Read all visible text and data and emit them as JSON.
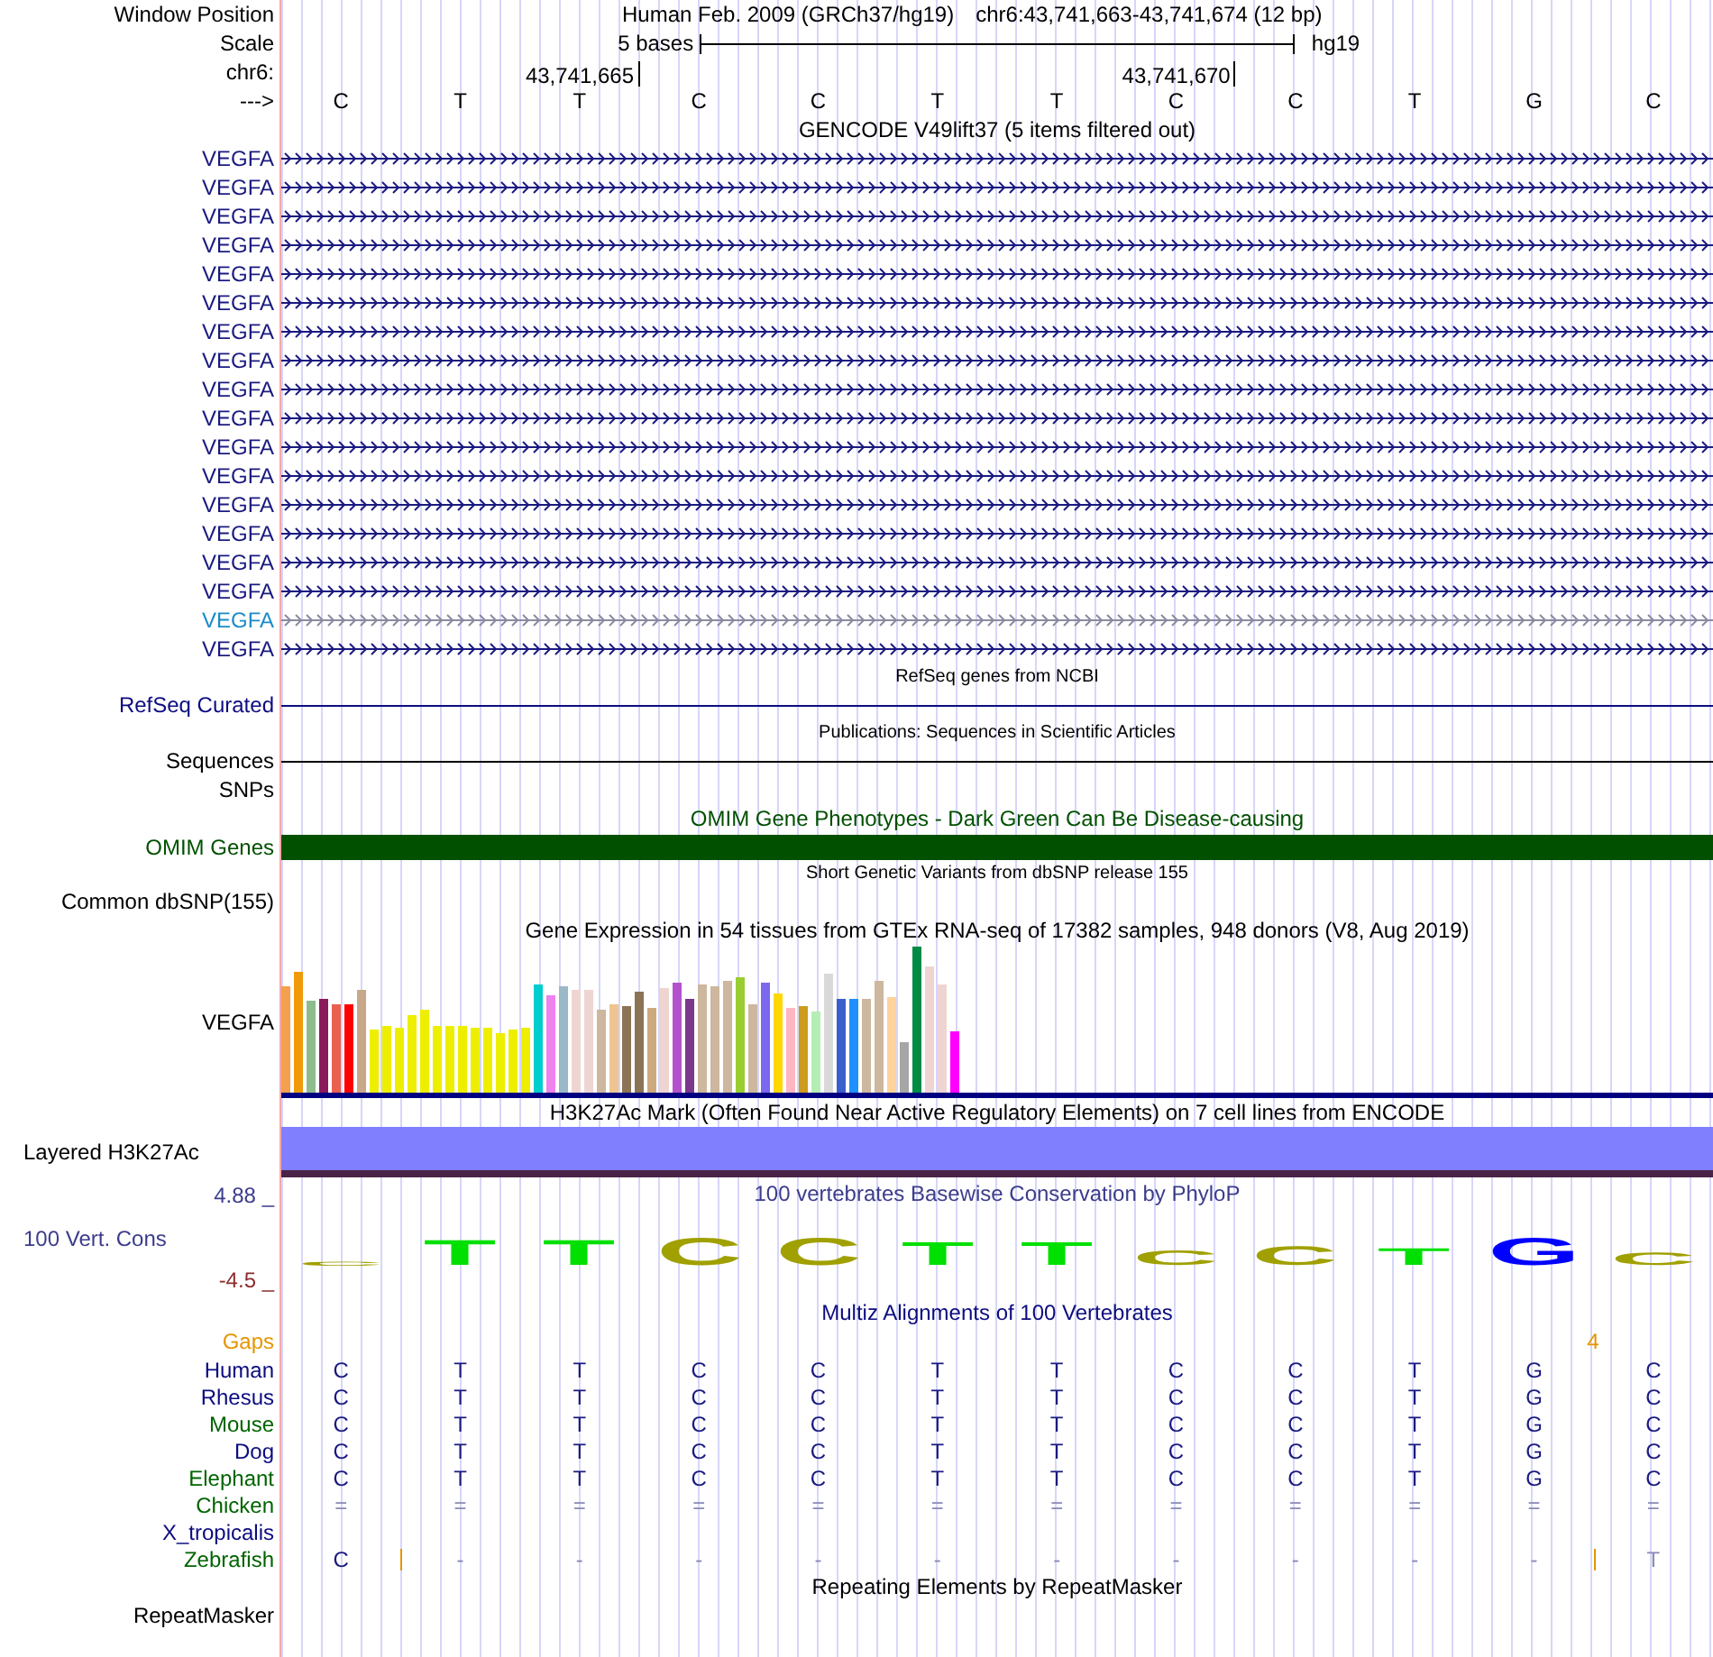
{
  "header": {
    "window_position_label": "Window Position",
    "assembly": "Human Feb. 2009 (GRCh37/hg19)",
    "position": "chr6:43,741,663-43,741,674 (12 bp)",
    "scale_label": "Scale",
    "scale_text": "5 bases",
    "scale_db": "hg19",
    "chrom_label": "chr6:",
    "ticks": [
      "43,741,665",
      "43,741,670"
    ],
    "strand_label": "--->",
    "bases": [
      "C",
      "T",
      "T",
      "C",
      "C",
      "T",
      "T",
      "C",
      "C",
      "T",
      "G",
      "C"
    ]
  },
  "tracks": [
    {
      "kind": "genes",
      "title": "GENCODE V49lift37 (5 items filtered out)",
      "small_title": false,
      "items": [
        {
          "name": "VEGFA",
          "highlighted": false
        },
        {
          "name": "VEGFA",
          "highlighted": false
        },
        {
          "name": "VEGFA",
          "highlighted": false
        },
        {
          "name": "VEGFA",
          "highlighted": false
        },
        {
          "name": "VEGFA",
          "highlighted": false
        },
        {
          "name": "VEGFA",
          "highlighted": false
        },
        {
          "name": "VEGFA",
          "highlighted": false
        },
        {
          "name": "VEGFA",
          "highlighted": false
        },
        {
          "name": "VEGFA",
          "highlighted": false
        },
        {
          "name": "VEGFA",
          "highlighted": false
        },
        {
          "name": "VEGFA",
          "highlighted": false
        },
        {
          "name": "VEGFA",
          "highlighted": false
        },
        {
          "name": "VEGFA",
          "highlighted": false
        },
        {
          "name": "VEGFA",
          "highlighted": false
        },
        {
          "name": "VEGFA",
          "highlighted": false
        },
        {
          "name": "VEGFA",
          "highlighted": false
        },
        {
          "name": "VEGFA",
          "highlighted": true
        },
        {
          "name": "VEGFA",
          "highlighted": false
        }
      ]
    },
    {
      "kind": "line",
      "title": "RefSeq genes from NCBI",
      "small_title": true,
      "label": "RefSeq Curated",
      "color": "#0c0c80"
    },
    {
      "kind": "line",
      "title": "Publications: Sequences in Scientific Articles",
      "small_title": true,
      "label": "Sequences",
      "color": "#000000"
    },
    {
      "kind": "empty",
      "label": "SNPs"
    },
    {
      "kind": "bar",
      "title": "OMIM Gene Phenotypes - Dark Green Can Be Disease-causing",
      "small_title": false,
      "label": "OMIM Genes",
      "color": "#005000"
    },
    {
      "kind": "empty",
      "title": "Short Genetic Variants from dbSNP release 155",
      "small_title": true,
      "label": "Common dbSNP(155)"
    },
    {
      "kind": "expression",
      "title": "Gene Expression in 54 tissues from GTEx RNA-seq of 17382 samples, 948 donors (V8, Aug 2019)",
      "small_title": false,
      "label": "VEGFA"
    },
    {
      "kind": "layered",
      "title": "H3K27Ac Mark (Often Found Near Active Regulatory Elements) on 7 cell lines from ENCODE",
      "small_title": false,
      "label": "Layered H3K27Ac",
      "color": "#8080ff"
    },
    {
      "kind": "phylop",
      "title": "100 vertebrates Basewise Conservation by PhyloP",
      "small_title": false,
      "label": "100 Vert. Cons",
      "axis_max": "4.88 _",
      "axis_min": "-4.5 _",
      "logo": [
        {
          "letter": "C",
          "color": "#a0a000"
        },
        {
          "letter": "T",
          "color": "#00e000"
        },
        {
          "letter": "T",
          "color": "#00e000"
        },
        {
          "letter": "C",
          "color": "#a0a000"
        },
        {
          "letter": "C",
          "color": "#a0a000"
        },
        {
          "letter": "T",
          "color": "#00e000"
        },
        {
          "letter": "T",
          "color": "#00e000"
        },
        {
          "letter": "C",
          "color": "#a0a000"
        },
        {
          "letter": "C",
          "color": "#a0a000"
        },
        {
          "letter": "T",
          "color": "#00e000"
        },
        {
          "letter": "G",
          "color": "#0000ff"
        },
        {
          "letter": "C",
          "color": "#a0a000"
        }
      ]
    },
    {
      "kind": "multiz",
      "title": "Multiz Alignments of 100 Vertebrates",
      "small_title": false,
      "gaps_label": "Gaps",
      "gap_columns": [
        {},
        {},
        {},
        {},
        {},
        {},
        {},
        {},
        {},
        {},
        {
          "count": "4"
        },
        {}
      ],
      "rows": [
        {
          "name": "Human",
          "color": "#0c0c80",
          "cells": [
            {
              "text": "C",
              "dim": false
            },
            {
              "text": "T",
              "dim": false
            },
            {
              "text": "T",
              "dim": false
            },
            {
              "text": "C",
              "dim": false
            },
            {
              "text": "C",
              "dim": false
            },
            {
              "text": "T",
              "dim": false
            },
            {
              "text": "T",
              "dim": false
            },
            {
              "text": "C",
              "dim": false
            },
            {
              "text": "C",
              "dim": false
            },
            {
              "text": "T",
              "dim": false
            },
            {
              "text": "G",
              "dim": false
            },
            {
              "text": "C",
              "dim": false
            }
          ]
        },
        {
          "name": "Rhesus",
          "color": "#0c0c80",
          "cells": [
            {
              "text": "C",
              "dim": false
            },
            {
              "text": "T",
              "dim": false
            },
            {
              "text": "T",
              "dim": false
            },
            {
              "text": "C",
              "dim": false
            },
            {
              "text": "C",
              "dim": false
            },
            {
              "text": "T",
              "dim": false
            },
            {
              "text": "T",
              "dim": false
            },
            {
              "text": "C",
              "dim": false
            },
            {
              "text": "C",
              "dim": false
            },
            {
              "text": "T",
              "dim": false
            },
            {
              "text": "G",
              "dim": false
            },
            {
              "text": "C",
              "dim": false
            }
          ]
        },
        {
          "name": "Mouse",
          "color": "#006400",
          "cells": [
            {
              "text": "C",
              "dim": false
            },
            {
              "text": "T",
              "dim": false
            },
            {
              "text": "T",
              "dim": false
            },
            {
              "text": "C",
              "dim": false
            },
            {
              "text": "C",
              "dim": false
            },
            {
              "text": "T",
              "dim": false
            },
            {
              "text": "T",
              "dim": false
            },
            {
              "text": "C",
              "dim": false
            },
            {
              "text": "C",
              "dim": false
            },
            {
              "text": "T",
              "dim": false
            },
            {
              "text": "G",
              "dim": false
            },
            {
              "text": "C",
              "dim": false
            }
          ]
        },
        {
          "name": "Dog",
          "color": "#0c0c80",
          "cells": [
            {
              "text": "C",
              "dim": false
            },
            {
              "text": "T",
              "dim": false
            },
            {
              "text": "T",
              "dim": false
            },
            {
              "text": "C",
              "dim": false
            },
            {
              "text": "C",
              "dim": false
            },
            {
              "text": "T",
              "dim": false
            },
            {
              "text": "T",
              "dim": false
            },
            {
              "text": "C",
              "dim": false
            },
            {
              "text": "C",
              "dim": false
            },
            {
              "text": "T",
              "dim": false
            },
            {
              "text": "G",
              "dim": false
            },
            {
              "text": "C",
              "dim": false
            }
          ]
        },
        {
          "name": "Elephant",
          "color": "#006400",
          "cells": [
            {
              "text": "C",
              "dim": false
            },
            {
              "text": "T",
              "dim": false
            },
            {
              "text": "T",
              "dim": false
            },
            {
              "text": "C",
              "dim": false
            },
            {
              "text": "C",
              "dim": false
            },
            {
              "text": "T",
              "dim": false
            },
            {
              "text": "T",
              "dim": false
            },
            {
              "text": "C",
              "dim": false
            },
            {
              "text": "C",
              "dim": false
            },
            {
              "text": "T",
              "dim": false
            },
            {
              "text": "G",
              "dim": false
            },
            {
              "text": "C",
              "dim": false
            }
          ]
        },
        {
          "name": "Chicken",
          "color": "#006400",
          "cells": [
            {
              "text": "=",
              "dim": true
            },
            {
              "text": "=",
              "dim": true
            },
            {
              "text": "=",
              "dim": true
            },
            {
              "text": "=",
              "dim": true
            },
            {
              "text": "=",
              "dim": true
            },
            {
              "text": "=",
              "dim": true
            },
            {
              "text": "=",
              "dim": true
            },
            {
              "text": "=",
              "dim": true
            },
            {
              "text": "=",
              "dim": true
            },
            {
              "text": "=",
              "dim": true
            },
            {
              "text": "=",
              "dim": true
            },
            {
              "text": "=",
              "dim": true
            }
          ]
        },
        {
          "name": "X_tropicalis",
          "color": "#0c0c80"
        },
        {
          "name": "Zebrafish",
          "color": "#006400",
          "cells": [
            {
              "text": "C",
              "dim": false,
              "insert_after": true
            },
            {
              "text": "-",
              "dim": true,
              "insert_after": false
            },
            {
              "text": "-",
              "dim": true,
              "insert_after": false
            },
            {
              "text": "-",
              "dim": true,
              "insert_after": false
            },
            {
              "text": "-",
              "dim": true,
              "insert_after": false
            },
            {
              "text": "-",
              "dim": true,
              "insert_after": false
            },
            {
              "text": "-",
              "dim": true,
              "insert_after": false
            },
            {
              "text": "-",
              "dim": true,
              "insert_after": false
            },
            {
              "text": "-",
              "dim": true,
              "insert_after": false
            },
            {
              "text": "-",
              "dim": true,
              "insert_after": false
            },
            {
              "text": "-",
              "dim": true,
              "insert_after": true
            },
            {
              "text": "T",
              "dim": true,
              "insert_after": false
            }
          ]
        }
      ]
    },
    {
      "kind": "empty",
      "title": "Repeating Elements by RepeatMasker",
      "small_title": false,
      "label": "RepeatMasker"
    }
  ]
}
